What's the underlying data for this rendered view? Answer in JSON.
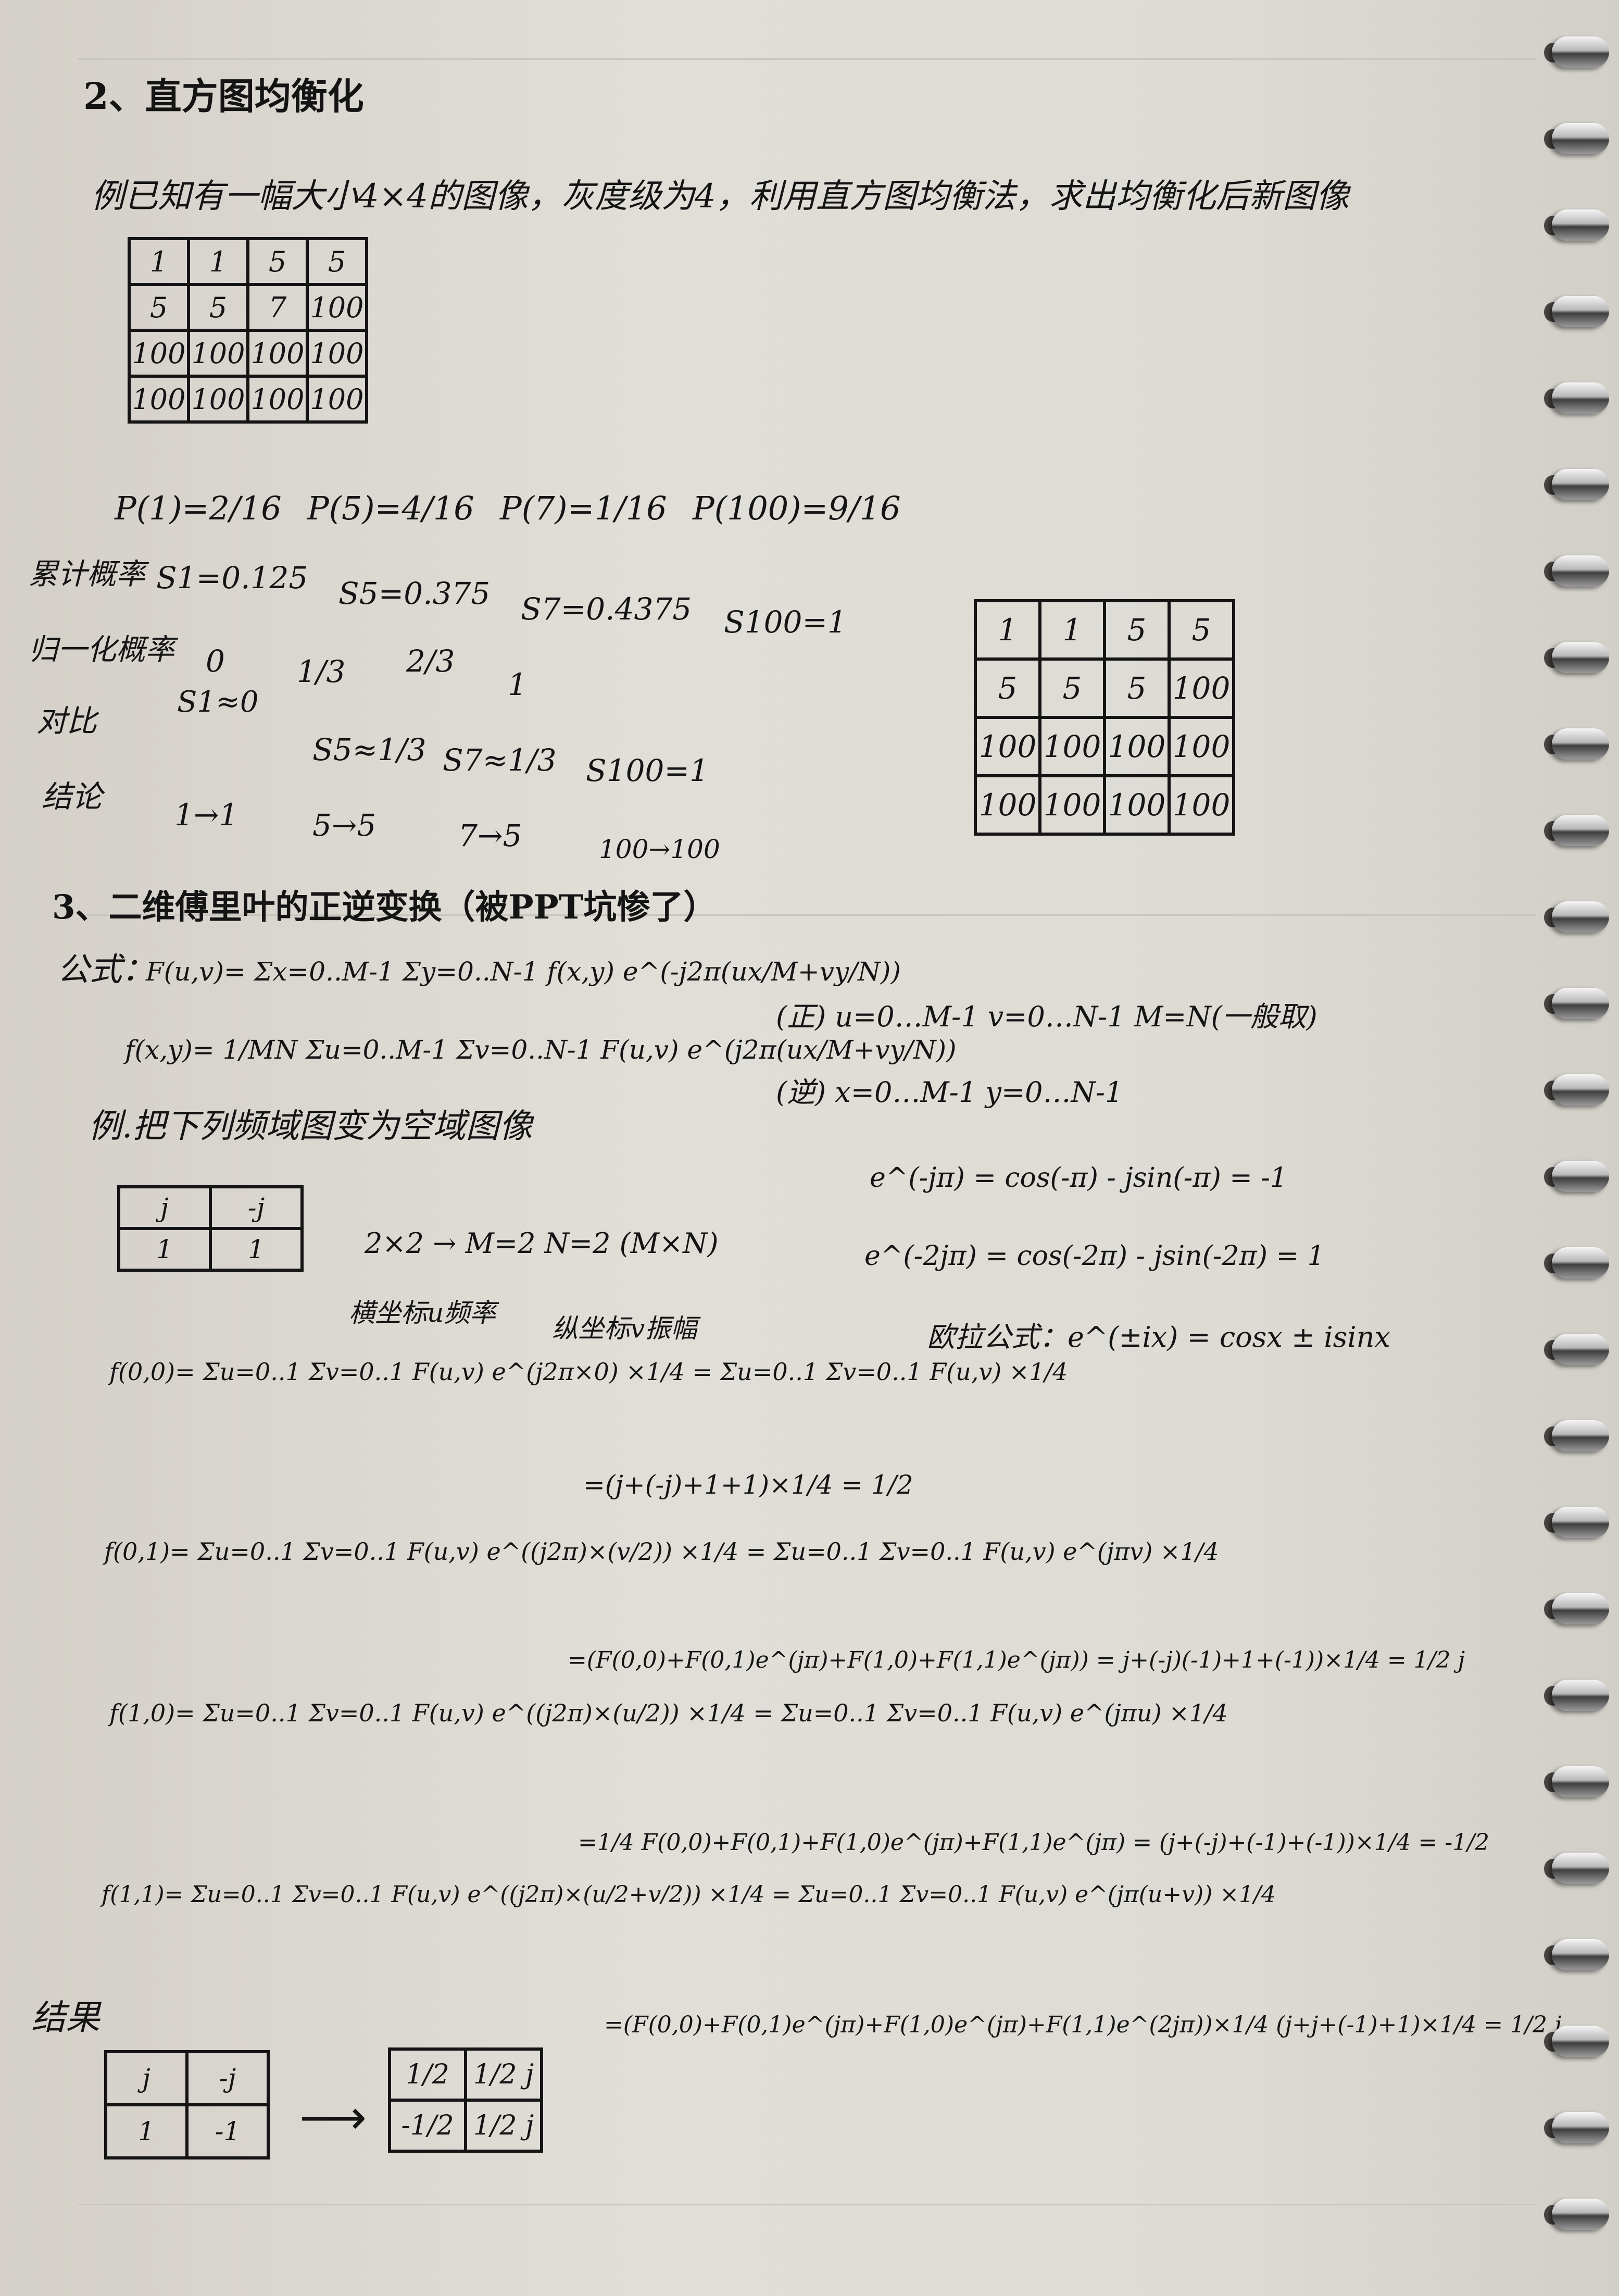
{
  "heading_hist": "2、直方图均衡化",
  "example_hist": "例已知有一幅大小4×4的图像，灰度级为4，利用直方图均衡法，求出均衡化后新图像",
  "orig_matrix": [
    [
      "1",
      "1",
      "5",
      "5"
    ],
    [
      "5",
      "5",
      "7",
      "100"
    ],
    [
      "100",
      "100",
      "100",
      "100"
    ],
    [
      "100",
      "100",
      "100",
      "100"
    ]
  ],
  "probabilities": [
    "P(1)=2/16",
    "P(5)=4/16",
    "P(7)=1/16",
    "P(100)=9/16"
  ],
  "cumulative": {
    "label": "累计概率",
    "values": [
      "S1=0.125",
      "S5=0.375",
      "S7=0.4375",
      "S100=1"
    ]
  },
  "normalized": {
    "label": "归一化概率",
    "values": [
      "0",
      "1/3",
      "2/3",
      "1"
    ],
    "extra": "S1≈0"
  },
  "compare": {
    "label": "对比",
    "values": [
      "S5≈1/3",
      "S7≈1/3",
      "S100=1"
    ]
  },
  "conclusion": {
    "label": "结论",
    "values": [
      "1→1",
      "5→5",
      "7→5",
      "100→100"
    ]
  },
  "result_matrix": [
    [
      "1",
      "1",
      "5",
      "5"
    ],
    [
      "5",
      "5",
      "5",
      "100"
    ],
    [
      "100",
      "100",
      "100",
      "100"
    ],
    [
      "100",
      "100",
      "100",
      "100"
    ]
  ],
  "heading_fourier": "3、二维傅里叶的正逆变换（被PPT坑惨了）",
  "formula_label": "公式：",
  "formula_forward": "F(u,v)= Σx=0..M-1 Σy=0..N-1 f(x,y) e^(-j2π(ux/M+vy/N))",
  "formula_inverse": "f(x,y)= 1/MN Σu=0..M-1 Σv=0..N-1 F(u,v) e^(j2π(ux/M+vy/N))",
  "forward_range": "(正) u=0…M-1   v=0…N-1   M=N(一般取)",
  "inverse_range": "(逆) x=0…M-1   y=0…N-1",
  "example_fourier": "例.把下列频域图变为空域图像",
  "freq_matrix": [
    [
      "j",
      "-j"
    ],
    [
      "1",
      "1"
    ]
  ],
  "size_note": "2×2 → M=2 N=2 (M×N)",
  "identity1": "e^(-jπ) = cos(-π) - jsin(-π) = -1",
  "identity2": "e^(-2jπ) = cos(-2π) - jsin(-2π) = 1",
  "euler": "欧拉公式：e^(±ix) = cosx ± isinx",
  "note_u": "横坐标u频率",
  "note_v": "纵坐标v振幅",
  "f00_a": "f(0,0)= Σu=0..1 Σv=0..1 F(u,v) e^(j2π×0) ×1/4 = Σu=0..1 Σv=0..1 F(u,v) ×1/4",
  "f00_b": "=(j+(-j)+1+1)×1/4 = 1/2",
  "f01_a": "f(0,1)= Σu=0..1 Σv=0..1 F(u,v) e^((j2π)×(v/2)) ×1/4 = Σu=0..1 Σv=0..1 F(u,v) e^(jπv) ×1/4",
  "f01_b": "=(F(0,0)+F(0,1)e^(jπ)+F(1,0)+F(1,1)e^(jπ)) = j+(-j)(-1)+1+(-1))×1/4 = 1/2 j",
  "f10_a": "f(1,0)= Σu=0..1 Σv=0..1 F(u,v) e^((j2π)×(u/2)) ×1/4 = Σu=0..1 Σv=0..1 F(u,v) e^(jπu) ×1/4",
  "f10_b": "=1/4 F(0,0)+F(0,1)+F(1,0)e^(jπ)+F(1,1)e^(jπ) = (j+(-j)+(-1)+(-1))×1/4 = -1/2",
  "f11_a": "f(1,1)= Σu=0..1 Σv=0..1 F(u,v) e^((j2π)×(u/2+v/2)) ×1/4 = Σu=0..1 Σv=0..1 F(u,v) e^(jπ(u+v)) ×1/4",
  "f11_b": "=(F(0,0)+F(0,1)e^(jπ)+F(1,0)e^(jπ)+F(1,1)e^(2jπ))×1/4 (j+j+(-1)+1)×1/4 = 1/2 j",
  "result_label": "结果",
  "final_freq": [
    [
      "j",
      "-j"
    ],
    [
      "1",
      "-1"
    ]
  ],
  "final_spatial": [
    [
      "1/2",
      "1/2 j"
    ],
    [
      "-1/2",
      "1/2 j"
    ]
  ]
}
